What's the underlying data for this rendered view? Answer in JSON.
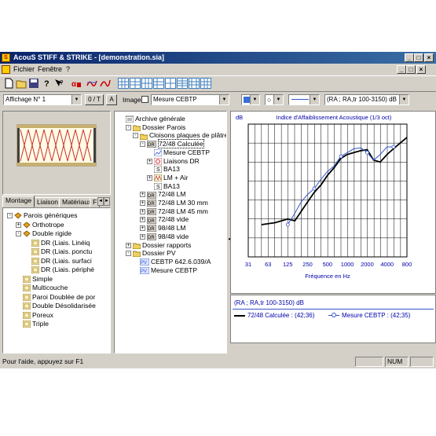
{
  "window": {
    "app_name": "AcouS STIFF & STRIKE",
    "document": "[demonstration.sia]",
    "title": "AcouS STIFF & STRIKE - [demonstration.sia]"
  },
  "menu": {
    "items": [
      "Fichier",
      "Fenêtre",
      "?"
    ]
  },
  "toolbar2": {
    "view_combo": "Affichage N° 1",
    "ot_button": "0 / T",
    "a_button": "A",
    "image_label": "Image",
    "measure_combo": "Mesure CEBTP",
    "index_combo": "(RA ; RA,tr 100-3150) dB"
  },
  "left_tabs": [
    "Montage",
    "Liaison",
    "Matériaux",
    "F"
  ],
  "left_tree": [
    {
      "label": "Parois génériques",
      "depth": 0,
      "expander": "-"
    },
    {
      "label": "Orthotrope",
      "depth": 1,
      "expander": "+"
    },
    {
      "label": "Double rigide",
      "depth": 1,
      "expander": "-"
    },
    {
      "label": "DR (Liais. Linéiq",
      "depth": 2,
      "expander": ""
    },
    {
      "label": "DR (Liais. ponctu",
      "depth": 2,
      "expander": ""
    },
    {
      "label": "DR (Liais. surfaci",
      "depth": 2,
      "expander": ""
    },
    {
      "label": "DR (Liais. périphé",
      "depth": 2,
      "expander": ""
    },
    {
      "label": "Simple",
      "depth": 1,
      "expander": ""
    },
    {
      "label": "Multicouche",
      "depth": 1,
      "expander": ""
    },
    {
      "label": "Paroi Doublée de por",
      "depth": 1,
      "expander": ""
    },
    {
      "label": "Double Désolidarisée",
      "depth": 1,
      "expander": ""
    },
    {
      "label": "Poreux",
      "depth": 1,
      "expander": ""
    },
    {
      "label": "Triple",
      "depth": 1,
      "expander": ""
    }
  ],
  "middle_tree": [
    {
      "label": "Archive générale",
      "depth": 0,
      "expander": "",
      "icon": "archive"
    },
    {
      "label": "Dossier Parois",
      "depth": 1,
      "expander": "-",
      "icon": "folder"
    },
    {
      "label": "Cloisons plaques de plâtre",
      "depth": 2,
      "expander": "-",
      "icon": "folder"
    },
    {
      "label": "72/48 Calculée",
      "depth": 3,
      "expander": "-",
      "icon": "dr",
      "selected": true
    },
    {
      "label": "Mesure CEBTP",
      "depth": 4,
      "expander": "",
      "icon": "measure"
    },
    {
      "label": "Liaisons DR",
      "depth": 4,
      "expander": "+",
      "icon": "link"
    },
    {
      "label": "BA13",
      "depth": 4,
      "expander": "",
      "icon": "s"
    },
    {
      "label": "LM + Air",
      "depth": 4,
      "expander": "+",
      "icon": "lm"
    },
    {
      "label": "BA13",
      "depth": 4,
      "expander": "",
      "icon": "s"
    },
    {
      "label": "72/48 LM",
      "depth": 3,
      "expander": "+",
      "icon": "dr"
    },
    {
      "label": "72/48 LM 30 mm",
      "depth": 3,
      "expander": "+",
      "icon": "dr"
    },
    {
      "label": "72/48 LM 45 mm",
      "depth": 3,
      "expander": "+",
      "icon": "dr"
    },
    {
      "label": "72/48 vide",
      "depth": 3,
      "expander": "+",
      "icon": "dr"
    },
    {
      "label": "98/48 LM",
      "depth": 3,
      "expander": "+",
      "icon": "dr"
    },
    {
      "label": "98/48 vide",
      "depth": 3,
      "expander": "+",
      "icon": "dr"
    },
    {
      "label": "Dossier rapports",
      "depth": 1,
      "expander": "+",
      "icon": "folder"
    },
    {
      "label": "Dossier PV",
      "depth": 1,
      "expander": "-",
      "icon": "folder"
    },
    {
      "label": "CEBTP 642.6.039/A",
      "depth": 2,
      "expander": "",
      "icon": "pv"
    },
    {
      "label": "Mesure CEBTP",
      "depth": 2,
      "expander": "",
      "icon": "pv"
    }
  ],
  "status": {
    "help": "Pour l'aide, appuyez sur F1",
    "num": "NUM"
  },
  "colors": {
    "calc_series": "#000000",
    "measure_series": "#3355cc",
    "titlebar": "#0a246a",
    "chart_title": "#0000aa"
  },
  "chart_data": {
    "type": "line",
    "title": "Indice d'Affaiblissement Acoustique (1/3 oct)",
    "ylabel": "dB",
    "xlabel": "Fréquence en Hz",
    "x_ticks": [
      "31",
      "63",
      "125",
      "250",
      "500",
      "1000",
      "2000",
      "4000",
      "800"
    ],
    "ylim": [
      0,
      70
    ],
    "grid": true,
    "x": [
      50,
      63,
      80,
      100,
      125,
      160,
      200,
      250,
      315,
      400,
      500,
      630,
      800,
      1000,
      1250,
      1600,
      2000,
      2500,
      3150,
      4000,
      5000,
      6300,
      8000
    ],
    "series": [
      {
        "name": "72/48 Calculée : (42;36)",
        "values": [
          17,
          17.5,
          18,
          19,
          20,
          19,
          24,
          29,
          34,
          38,
          43,
          47,
          52,
          54,
          55,
          56,
          56.5,
          51,
          50,
          54,
          57,
          60,
          63
        ]
      },
      {
        "name": "Mesure CEBTP : (42;35)",
        "values": [
          null,
          null,
          null,
          null,
          17,
          23,
          29,
          33,
          36,
          41,
          45,
          48,
          53,
          55,
          57,
          57.5,
          55,
          51,
          54,
          58,
          58,
          null,
          null
        ]
      }
    ],
    "legend_header": "(RA ; RA,tr 100-3150) dB",
    "legend_entries": [
      "72/48 Calculée : (42;36)",
      "Mesure CEBTP : (42;35)"
    ]
  }
}
